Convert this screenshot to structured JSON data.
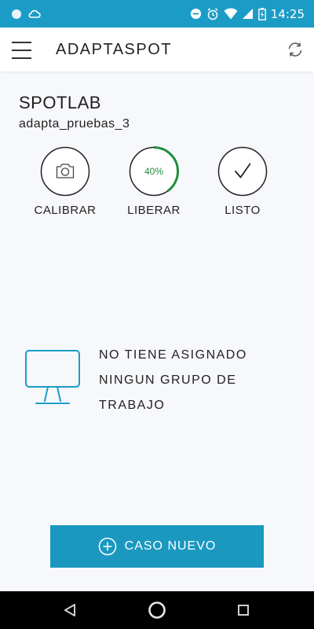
{
  "status_bar": {
    "time": "14:25",
    "icons": [
      "circle-icon",
      "cloud-icon",
      "do-not-disturb-icon",
      "alarm-icon",
      "wifi-icon",
      "cellular-signal-icon",
      "battery-charging-icon"
    ]
  },
  "app_bar": {
    "title": "ADAPTASPOT",
    "menu_icon": "hamburger-menu-icon",
    "sync_icon": "sync-icon"
  },
  "spot": {
    "name": "SPOTLAB",
    "user": "adapta_pruebas_3"
  },
  "actions": [
    {
      "label": "CALIBRAR",
      "icon": "camera-icon"
    },
    {
      "label": "LIBERAR",
      "progress_text": "40%",
      "progress": 0.4
    },
    {
      "label": "LISTO",
      "icon": "checkmark-icon"
    }
  ],
  "empty_state": {
    "icon": "monitor-icon",
    "lines": [
      "NO TIENE ASIGNADO",
      "NINGUN GRUPO DE",
      "TRABAJO"
    ]
  },
  "new_case_button": {
    "label": "CASO NUEVO",
    "icon": "plus-circle-icon"
  },
  "nav_bar": {
    "icons": [
      "back-icon",
      "home-icon",
      "recents-icon"
    ]
  },
  "colors": {
    "primary": "#1b9cc7",
    "button": "#1a98c0",
    "progress": "#1e8e3e",
    "background": "#f7f8fb"
  }
}
